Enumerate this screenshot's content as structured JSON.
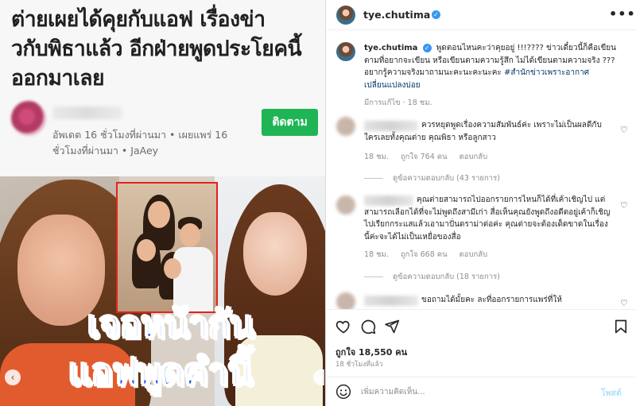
{
  "article": {
    "headline": "ต่ายเผยได้คุยกับแอฟ เรื่องข่าวกับพิธาแล้ว อีกฝ่ายพูดประโยคนี้ออกมาเลย",
    "meta": "อัพเดต 16 ชั่วโมงที่ผ่านมา • เผยแพร่ 16 ชั่วโมงที่ผ่านมา • JaAey",
    "follow_label": "ติดตาม",
    "thumbnail_text_1": "เจอหน้ากัน",
    "thumbnail_text_2": "แอฟพูดคำนี้",
    "carousel_prev": "‹"
  },
  "post": {
    "username": "tye.chutima",
    "verified_mark": "✓",
    "more": "•••",
    "caption_text": "พูดตอนไหนคะว่าคุยอยู่ !!!???? ข่าวเดี๋ยวนี้ก็คือเขียนตามที่อยากจะเขียน หรือเขียนตามความรู้สึก ไม่ได้เขียนตามความจริง ??? อยากรู้ความจริงมาถามนะคะนะคะนะคะ",
    "caption_hashtag": "#สำนักข่าวเพราะอากาศเปลี่ยนแปลงบ่อย",
    "caption_meta": "มีการแก้ไข · 18 ชม.",
    "likes": "ถูกใจ 18,550 คน",
    "time": "18 ชั่วโมงที่แล้ว",
    "comment_placeholder": "เพิ่มความคิดเห็น...",
    "post_label": "โพสต์"
  },
  "comments": [
    {
      "name": "username",
      "text": "ควรหยุดพูดเรื่องความสัมพันธ์ค่ะ เพราะไม่เป็นผลดีกับใครเลยทั้งคุณต่าย คุณพิธา หรือลูกสาว",
      "time": "18 ชม.",
      "likes": "ถูกใจ 764 คน",
      "reply": "ตอบกลับ",
      "replies": "ดูข้อความตอบกลับ (43 รายการ)"
    },
    {
      "name": "username",
      "text": "คุณต่ายสามารถไปออกรายการไหนก็ได้ที่เค้าเชิญไป แต่สามารถเลือกได้ที่จะไม่พูดถึงสามีเก่า สื่อเห็นคุณยังพูดถึงอดีตอยู่เค้าก็เชิญไปเรียกกระแสแล้วเอามาปั่นดราม่าต่อค่ะ คุณต่ายจะต้องเด็ดขาดในเรื่องนี้ค่ะจะได้ไม่เป็นเหยื่อของสื่อ",
      "time": "18 ชม.",
      "likes": "ถูกใจ 668 คน",
      "reply": "ตอบกลับ",
      "replies": "ดูข้อความตอบกลับ (18 รายการ)"
    },
    {
      "name": "username",
      "text": "ขอถามได้มั้ยคะ ละที่ออกรายการแพร่ที่ให้"
    }
  ],
  "colors": {
    "follow_button": "#1fb455",
    "overlay_text": "#1653e6",
    "verified": "#3897f0",
    "hashtag": "#00376b"
  }
}
